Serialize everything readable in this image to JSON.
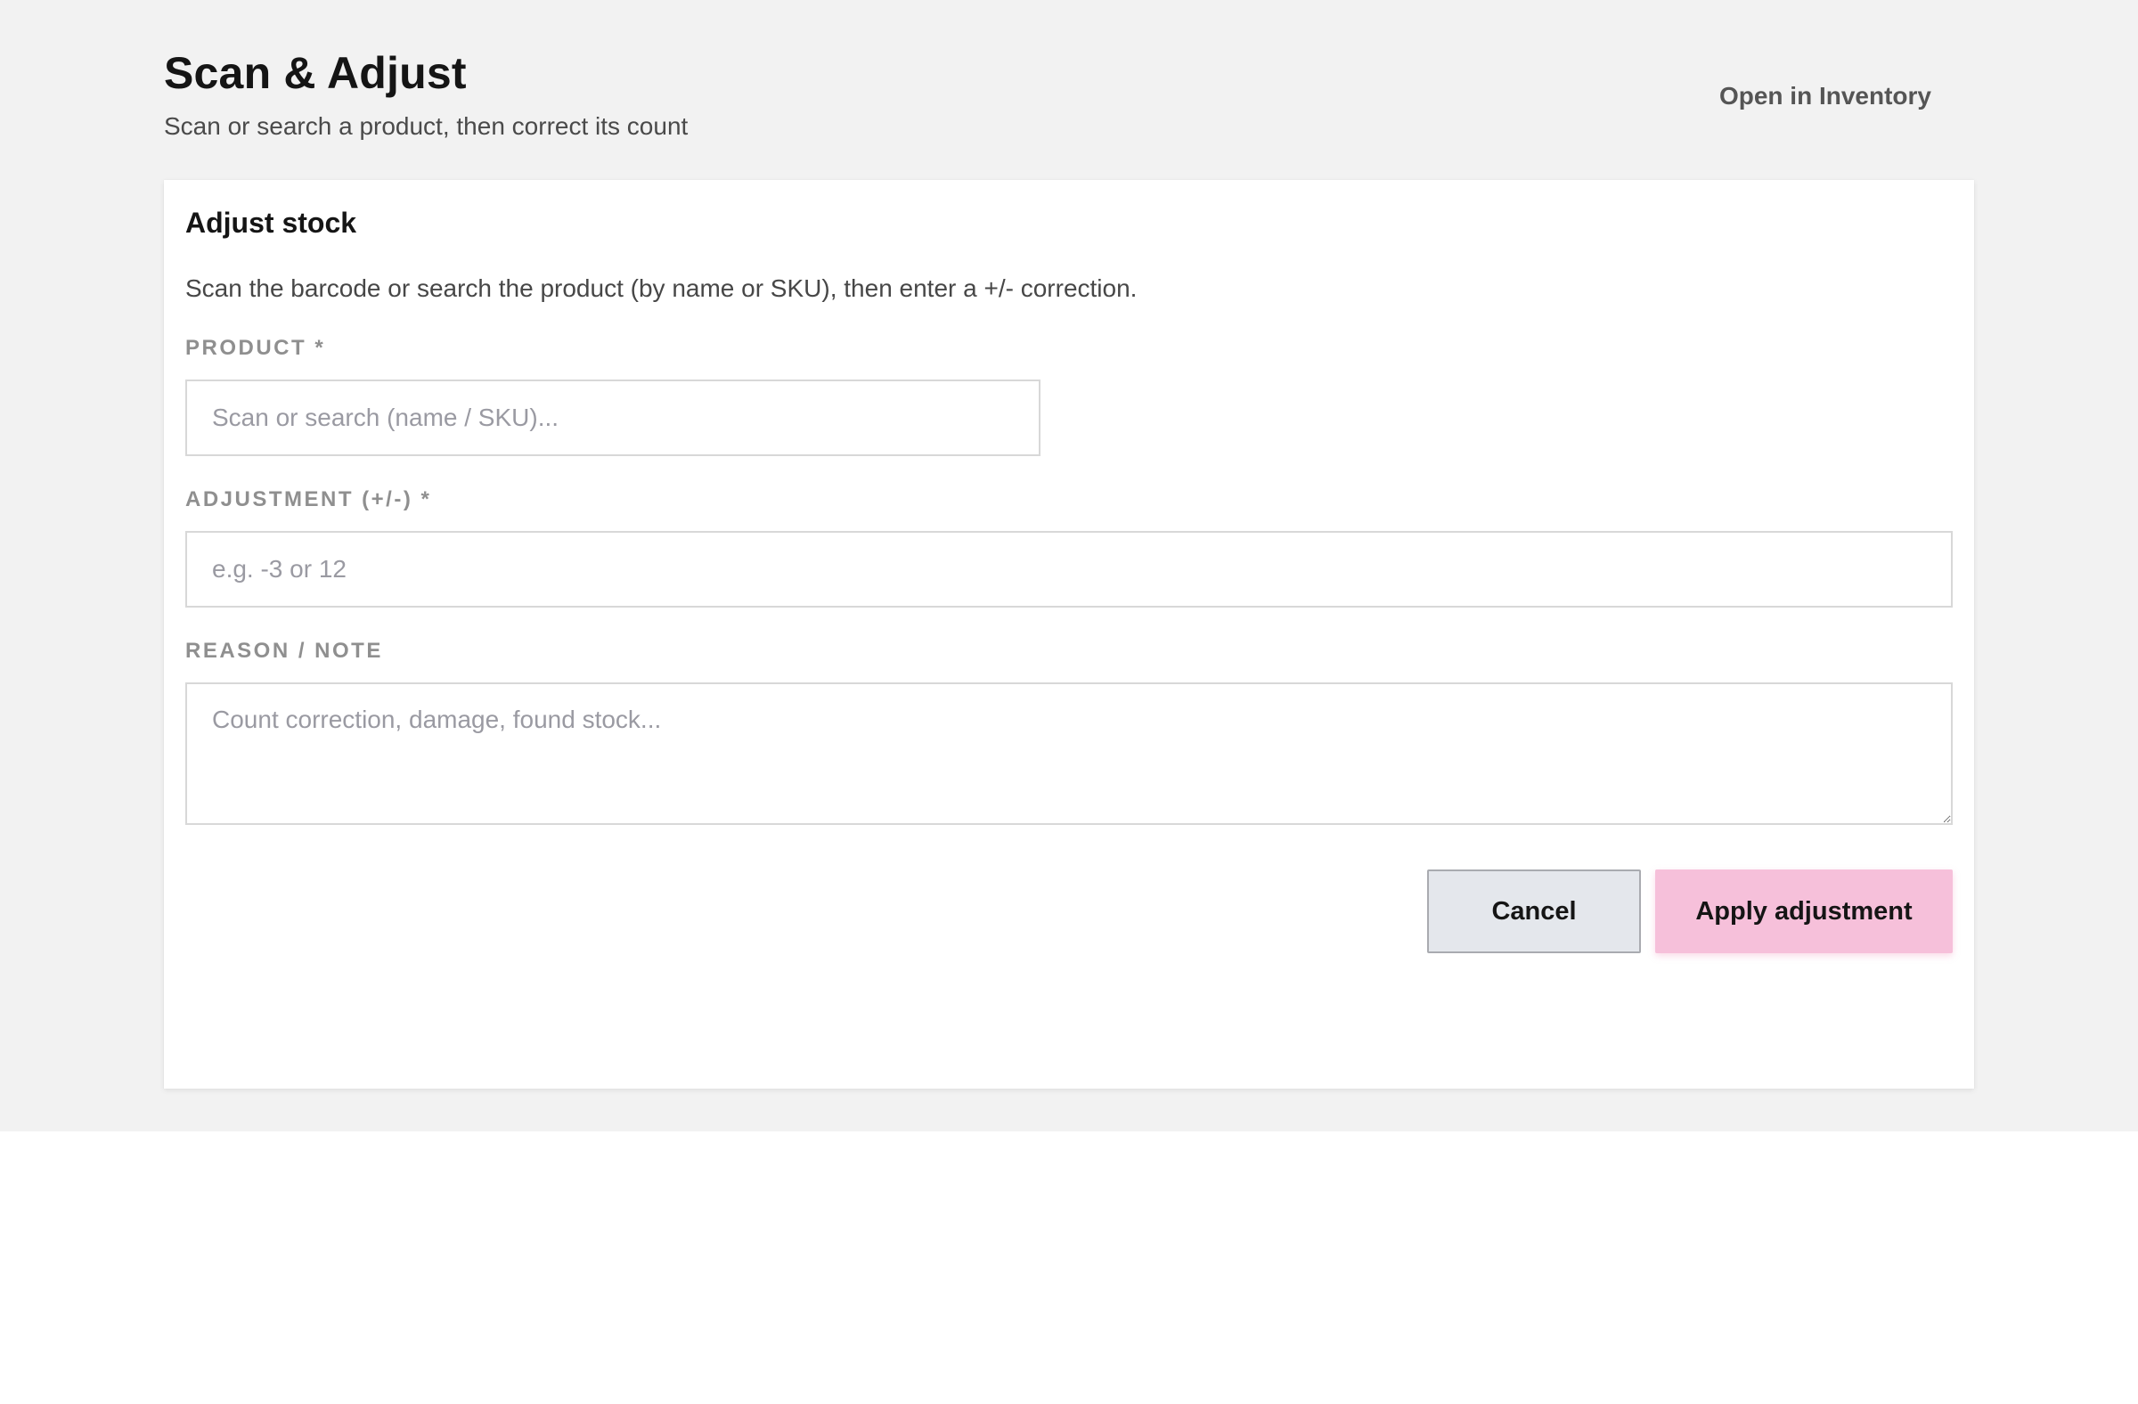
{
  "header": {
    "title": "Scan & Adjust",
    "subtitle": "Scan or search a product, then correct its count",
    "open_inventory_label": "Open in Inventory"
  },
  "card": {
    "title": "Adjust stock",
    "description": "Scan the barcode or search the product (by name or SKU), then enter a +/- correction.",
    "fields": {
      "product": {
        "label": "PRODUCT *",
        "placeholder": "Scan or search (name / SKU)...",
        "value": ""
      },
      "adjustment": {
        "label": "ADJUSTMENT (+/-) *",
        "placeholder": "e.g. -3 or 12",
        "value": ""
      },
      "reason": {
        "label": "REASON / NOTE",
        "placeholder": "Count correction, damage, found stock...",
        "value": ""
      }
    },
    "actions": {
      "cancel_label": "Cancel",
      "apply_label": "Apply adjustment"
    }
  },
  "colors": {
    "page_background": "#f2f2f2",
    "card_background": "#ffffff",
    "apply_button": "#f6c0da",
    "cancel_button": "#e4e7ec",
    "label_text": "#8f8f8f"
  }
}
